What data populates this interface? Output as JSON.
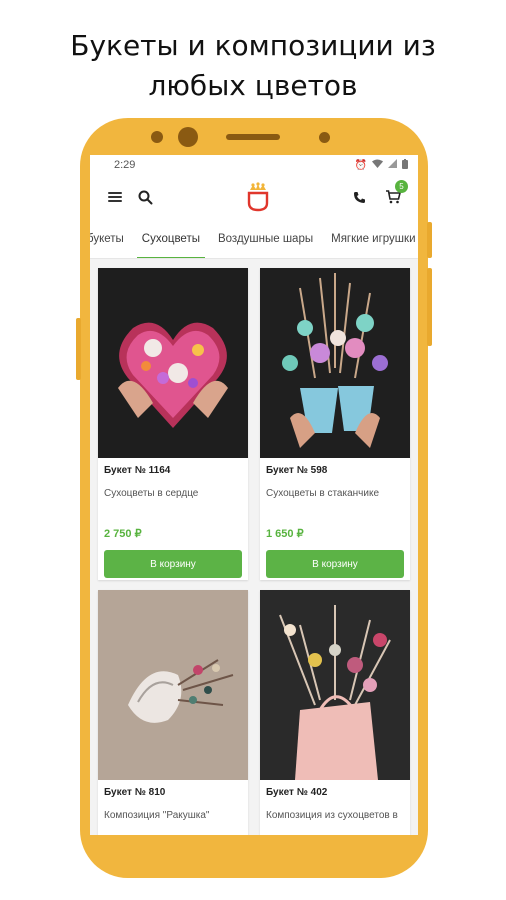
{
  "promo": {
    "line1": "Букеты и композиции из",
    "line2": "любых цветов"
  },
  "status": {
    "time": "2:29"
  },
  "header": {
    "cart_count": "5"
  },
  "tabs": [
    "букеты",
    "Сухоцветы",
    "Воздушные шары",
    "Мягкие игрушки"
  ],
  "products": [
    {
      "title": "Букет № 1164",
      "desc": "Сухоцветы в сердце",
      "price": "2 750 ₽",
      "button": "В корзину"
    },
    {
      "title": "Букет № 598",
      "desc": "Сухоцветы в стаканчике",
      "price": "1 650 ₽",
      "button": "В корзину"
    },
    {
      "title": "Букет № 810",
      "desc": "Композиция \"Ракушка\"",
      "price": "",
      "button": ""
    },
    {
      "title": "Букет № 402",
      "desc": "Композиция из сухоцветов в",
      "price": "",
      "button": ""
    }
  ],
  "colors": {
    "frame": "#f1b63e",
    "accent": "#58b33f"
  }
}
